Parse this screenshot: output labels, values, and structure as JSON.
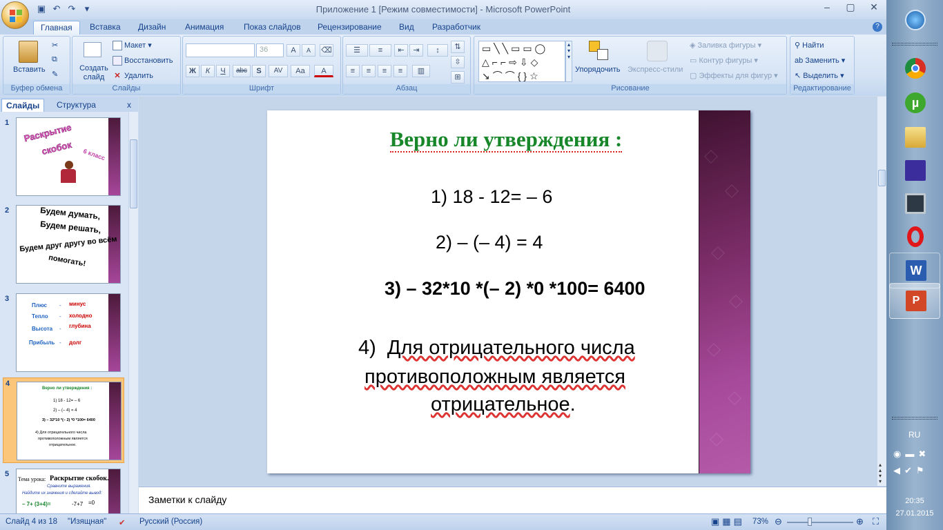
{
  "window": {
    "title": "Приложение 1 [Режим совместимости] - Microsoft PowerPoint"
  },
  "tabs": [
    "Главная",
    "Вставка",
    "Дизайн",
    "Анимация",
    "Показ слайдов",
    "Рецензирование",
    "Вид",
    "Разработчик"
  ],
  "ribbon": {
    "clipboard": {
      "paste": "Вставить",
      "label": "Буфер обмена"
    },
    "slides": {
      "new_slide": "Создать слайд",
      "layout": "Макет",
      "reset": "Восстановить",
      "delete": "Удалить",
      "label": "Слайды"
    },
    "font": {
      "size": "36",
      "label": "Шрифт",
      "bold": "Ж",
      "italic": "К",
      "underline": "Ч",
      "strike": "abc",
      "shadow": "S",
      "spacing": "AV",
      "case": "Aa",
      "color": "A",
      "grow": "A",
      "shrink": "A"
    },
    "paragraph": {
      "label": "Абзац"
    },
    "drawing": {
      "arrange": "Упорядочить",
      "quick_styles": "Экспресс-стили",
      "fill": "Заливка фигуры",
      "outline": "Контур фигуры",
      "effects": "Эффекты для фигур",
      "label": "Рисование"
    },
    "editing": {
      "find": "Найти",
      "replace": "Заменить",
      "select": "Выделить",
      "label": "Редактирование"
    }
  },
  "pane": {
    "tab_slides": "Слайды",
    "tab_outline": "Структура",
    "close": "x"
  },
  "thumbnails": [
    {
      "num": "1",
      "lines": [
        "Раскрытие",
        "скобок",
        "6 класс"
      ]
    },
    {
      "num": "2",
      "lines": [
        "Будем думать,",
        "Будем решать,",
        "Будем друг другу во всём",
        "помогать!"
      ]
    },
    {
      "num": "3",
      "left": [
        "Плюс",
        "Тепло",
        "Высота",
        "Прибыль"
      ],
      "right": [
        "минус",
        "холодно",
        "глубина",
        "долг"
      ]
    },
    {
      "num": "4",
      "lines": [
        "Верно ли утверждения :",
        "1) 18 - 12= – 6",
        "2) – (– 4) = 4",
        "3) – 32*10 *(– 2) *0 *100= 6400",
        "4) Для отрицательного числа",
        "противоположным является",
        "отрицательное."
      ]
    },
    {
      "num": "5",
      "lines": [
        "Тема урока:",
        "Раскрытие скобок.",
        "Сравните выражения.",
        "Найдите их значения и сделайте вывод:",
        "– 7+ (3+4)=",
        "-7+7",
        "=0"
      ]
    }
  ],
  "slide": {
    "title": "Верно ли утверждения :",
    "items": [
      "1) 18 - 12= – 6",
      "2) – (– 4) = 4",
      "3) – 32*10 *(– 2) *0 *100= 6400"
    ],
    "item4_num": "4)",
    "item4_lines": [
      "Для отрицательного числа",
      "противоположным является",
      "отрицательное"
    ],
    "item4_end": "."
  },
  "notes": {
    "placeholder": "Заметки к слайду"
  },
  "status": {
    "slide_info": "Слайд 4 из 18",
    "theme": "\"Изящная\"",
    "language": "Русский (Россия)",
    "zoom": "73%"
  },
  "tray": {
    "lang": "RU",
    "time": "20:35",
    "date": "27.01.2015"
  },
  "colors": {
    "title_green": "#17872a",
    "accent_purple": "#a84a9c",
    "selected_thumb": "#fbc57a"
  }
}
